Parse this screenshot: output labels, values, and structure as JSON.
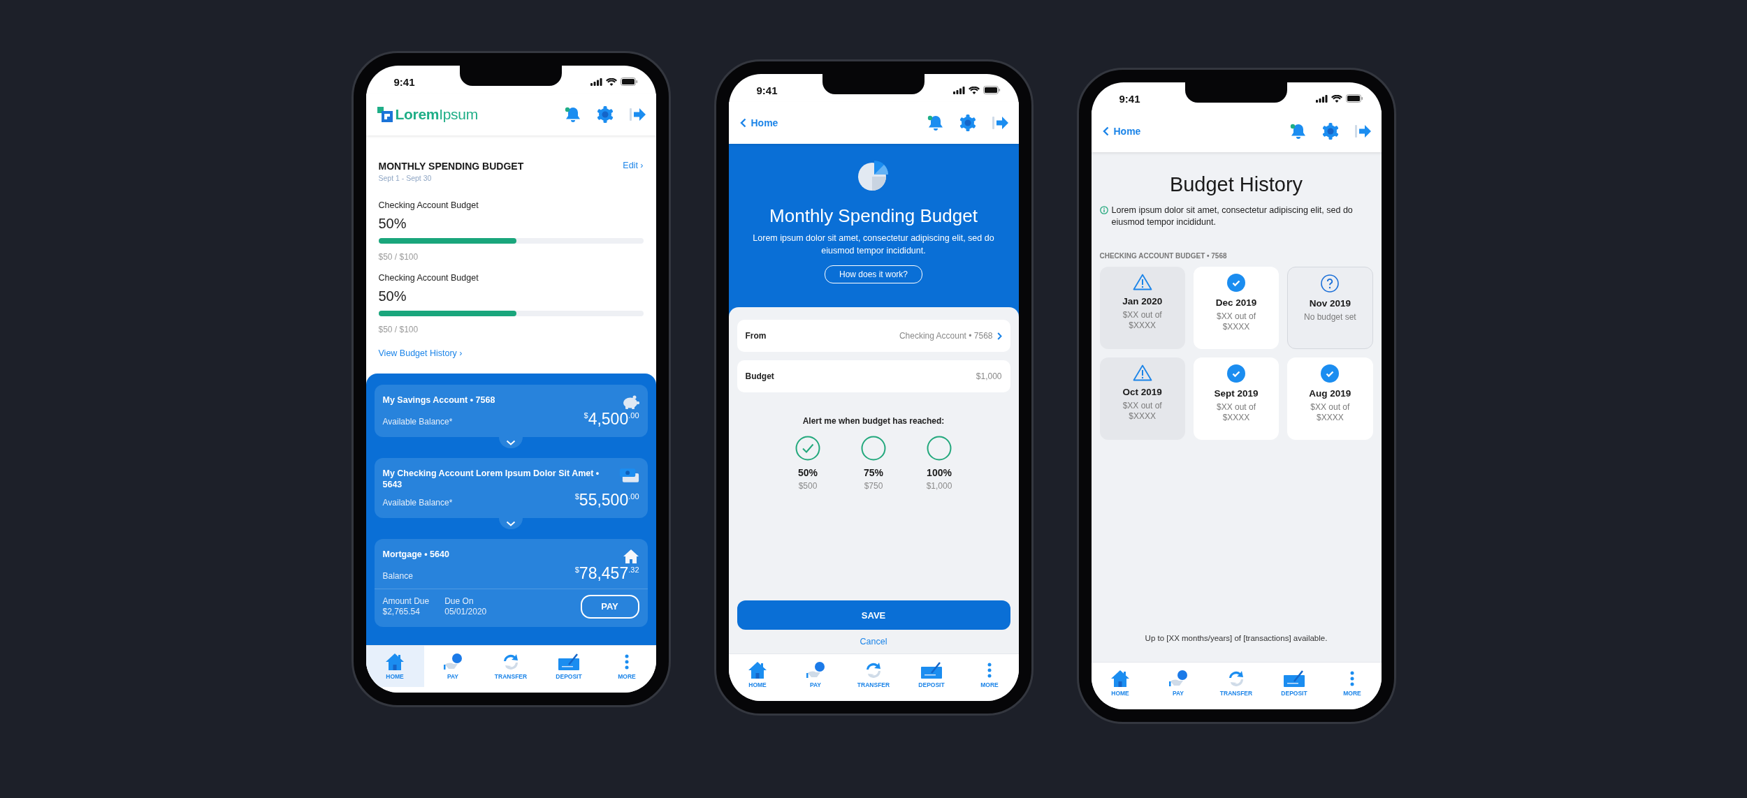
{
  "screens": [
    {
      "kind": "accounts",
      "status_bar": {
        "time": "9:41"
      },
      "header": {
        "logo": "**Lorem**Ipsum"
      },
      "budget": {
        "title": "MONTHLY SPENDING BUDGET",
        "dates": "Sept 1 - Sept 30",
        "edit_link": "Edit ›",
        "items": [
          {
            "name": "Checking Account Budget",
            "percent": "50%",
            "level": 0.52,
            "amount": "$50 / $100"
          },
          {
            "name": "Checking Account Budget",
            "percent": "50%",
            "level": 0.52,
            "amount": "$50 / $100"
          }
        ],
        "history_link": "View Budget History ›"
      },
      "accounts": [
        {
          "kind": "savings",
          "name": "My Savings Account • 7568",
          "label": "Available Balance*",
          "balance": "$^{$}$4,500$^{.00}$",
          "expandable": true
        },
        {
          "kind": "checking",
          "name": "My Checking Account Lorem Ipsum Dolor Sit Amet • 5643",
          "label": "Available Balance*",
          "balance": "$^{$}$55,500$^{.00}$",
          "expandable": true
        },
        {
          "kind": "mortgage",
          "name": "Mortgage • 5640",
          "label": "Balance",
          "balance": "$^{$}$78,457$^{.32}$",
          "expandable": false,
          "due": {
            "amount_label": "Amount Due",
            "amount": "$2,765.54",
            "date_label": "Due On",
            "date": "05/01/2020",
            "button": "PAY"
          }
        }
      ],
      "tab_bar": [
        {
          "kind": "home",
          "label": "HOME",
          "selected": true
        },
        {
          "kind": "pay",
          "label": "PAY",
          "selected": false
        },
        {
          "kind": "transfer",
          "label": "TRANSFER",
          "selected": false
        },
        {
          "kind": "deposit",
          "label": "DEPOSIT",
          "selected": false
        },
        {
          "kind": "more",
          "label": "MORE",
          "selected": false
        }
      ]
    },
    {
      "kind": "budget_form",
      "status_bar": {
        "time": "9:41"
      },
      "header": {
        "back": "Home"
      },
      "hero": {
        "title": "Monthly Spending Budget",
        "description": "Lorem ipsum dolor sit amet, consectetur adipiscing elit, sed do eiusmod tempor incididunt.",
        "button": "How does it work?"
      },
      "form": [
        {
          "label": "From",
          "value": "Checking Account • 7568",
          "chevron": true
        },
        {
          "label": "Budget",
          "value": "$1,000",
          "chevron": false
        }
      ],
      "alert": {
        "title": "Alert me when budget has reached:",
        "options": [
          {
            "percent": "50%",
            "amount": "$500",
            "checked": true
          },
          {
            "percent": "75%",
            "amount": "$750",
            "checked": false
          },
          {
            "percent": "100%",
            "amount": "$1,000",
            "checked": false
          }
        ]
      },
      "save_button": "SAVE",
      "cancel_link": "Cancel",
      "tab_bar": [
        {
          "kind": "home",
          "label": "HOME",
          "selected": false
        },
        {
          "kind": "pay",
          "label": "PAY",
          "selected": false
        },
        {
          "kind": "transfer",
          "label": "TRANSFER",
          "selected": false
        },
        {
          "kind": "deposit",
          "label": "DEPOSIT",
          "selected": false
        },
        {
          "kind": "more",
          "label": "MORE",
          "selected": false
        }
      ]
    },
    {
      "kind": "history",
      "status_bar": {
        "time": "9:41"
      },
      "header": {
        "back": "Home"
      },
      "title": "Budget History",
      "info": "Lorem ipsum dolor sit amet, consectetur adipiscing elit, sed do eiusmod tempor incididunt.",
      "section_title": "CHECKING ACCOUNT BUDGET • 7568",
      "months": [
        {
          "kind": "warning",
          "month": "Jan 2020",
          "detail": "$XX out of $XXXX"
        },
        {
          "kind": "ok",
          "month": "Dec 2019",
          "detail": "$XX out of $XXXX"
        },
        {
          "kind": "none",
          "month": "Nov 2019",
          "detail": "No budget set"
        },
        {
          "kind": "warning",
          "month": "Oct 2019",
          "detail": "$XX out of $XXXX"
        },
        {
          "kind": "ok",
          "month": "Sept 2019",
          "detail": "$XX out of $XXXX"
        },
        {
          "kind": "ok",
          "month": "Aug 2019",
          "detail": "$XX out of $XXXX"
        }
      ],
      "footer": "Up to [XX months/years] of [transactions] available.",
      "tab_bar": [
        {
          "kind": "home",
          "label": "HOME",
          "selected": false
        },
        {
          "kind": "pay",
          "label": "PAY",
          "selected": false
        },
        {
          "kind": "transfer",
          "label": "TRANSFER",
          "selected": false
        },
        {
          "kind": "deposit",
          "label": "DEPOSIT",
          "selected": false
        },
        {
          "kind": "more",
          "label": "MORE",
          "selected": false
        }
      ]
    }
  ]
}
